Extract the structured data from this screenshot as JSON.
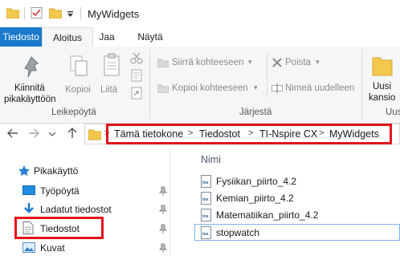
{
  "window": {
    "title": "MyWidgets"
  },
  "tabs": {
    "file": "Tiedosto",
    "home": "Aloitus",
    "share": "Jaa",
    "view": "Näytä"
  },
  "ribbon": {
    "pin_line1": "Kiinnitä",
    "pin_line2": "pikakäyttöön",
    "copy": "Kopioi",
    "paste": "Liitä",
    "clipboard_group": "Leikepöytä",
    "move_to": "Siirrä kohteeseen",
    "copy_to": "Kopioi kohteeseen",
    "delete": "Poista",
    "rename": "Nimeä uudelleen",
    "organize_group": "Järjestä",
    "new_folder_line1": "Uusi",
    "new_folder_line2": "kansio",
    "new_group_partial": "Uus"
  },
  "address": {
    "crumbs": [
      "Tämä tietokone",
      "Tiedostot",
      "TI-Nspire CX",
      "MyWidgets"
    ],
    "separator": ">"
  },
  "nav": {
    "quick_access": "Pikakäyttö",
    "desktop": "Työpöytä",
    "downloads": "Ladatut tiedostot",
    "documents": "Tiedostot",
    "pictures": "Kuvat"
  },
  "files": {
    "column_name": "Nimi",
    "icon_text": "tns",
    "items": [
      "Fysiikan_piirto_4.2",
      "Kemian_piirto_4.2",
      "Matematiikan_piirto_4.2",
      "stopwatch"
    ]
  },
  "colors": {
    "accent": "#1979ca",
    "highlight": "#e3141b",
    "folder": "#f2c94c"
  }
}
